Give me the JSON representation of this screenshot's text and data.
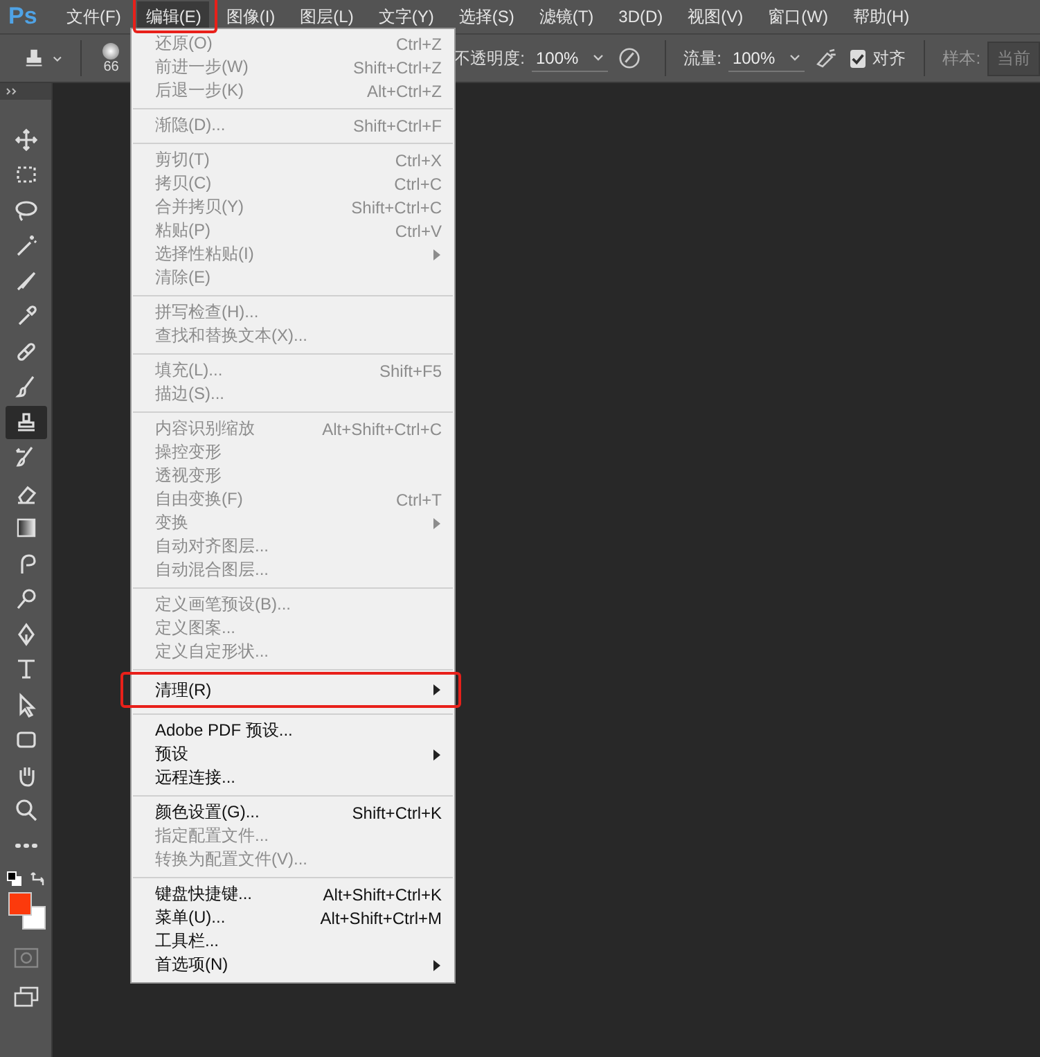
{
  "menubar": {
    "logo": "Ps",
    "items": [
      {
        "label": "文件(F)",
        "selected": false,
        "annotated": false
      },
      {
        "label": "编辑(E)",
        "selected": true,
        "annotated": true
      },
      {
        "label": "图像(I)",
        "selected": false,
        "annotated": false
      },
      {
        "label": "图层(L)",
        "selected": false,
        "annotated": false
      },
      {
        "label": "文字(Y)",
        "selected": false,
        "annotated": false
      },
      {
        "label": "选择(S)",
        "selected": false,
        "annotated": false
      },
      {
        "label": "滤镜(T)",
        "selected": false,
        "annotated": false
      },
      {
        "label": "3D(D)",
        "selected": false,
        "annotated": false
      },
      {
        "label": "视图(V)",
        "selected": false,
        "annotated": false
      },
      {
        "label": "窗口(W)",
        "selected": false,
        "annotated": false
      },
      {
        "label": "帮助(H)",
        "selected": false,
        "annotated": false
      }
    ]
  },
  "options_bar": {
    "brush_size": "66",
    "opacity_label": "不透明度:",
    "opacity_value": "100%",
    "flow_label": "流量:",
    "flow_value": "100%",
    "aligned": {
      "label": "对齐",
      "checked": true
    },
    "sample_label": "样本:",
    "sample_value": "当前"
  },
  "toolbar": {
    "tools": [
      {
        "selected": false
      },
      {
        "selected": false
      },
      {
        "selected": false
      },
      {
        "selected": false
      },
      {
        "selected": false
      },
      {
        "selected": false
      },
      {
        "selected": false
      },
      {
        "selected": false
      },
      {
        "selected": true
      },
      {
        "selected": false
      },
      {
        "selected": false
      },
      {
        "selected": false
      },
      {
        "selected": false
      },
      {
        "selected": false
      },
      {
        "selected": false
      },
      {
        "selected": false
      },
      {
        "selected": false
      },
      {
        "selected": false
      },
      {
        "selected": false
      },
      {
        "selected": false
      },
      {
        "selected": false
      }
    ]
  },
  "edit_menu": {
    "groups": [
      {
        "items": [
          {
            "label": "还原(O)",
            "shortcut": "Ctrl+Z",
            "disabled": true,
            "submenu": false,
            "annotated": false
          },
          {
            "label": "前进一步(W)",
            "shortcut": "Shift+Ctrl+Z",
            "disabled": true,
            "submenu": false,
            "annotated": false
          },
          {
            "label": "后退一步(K)",
            "shortcut": "Alt+Ctrl+Z",
            "disabled": true,
            "submenu": false,
            "annotated": false
          }
        ]
      },
      {
        "items": [
          {
            "label": "渐隐(D)...",
            "shortcut": "Shift+Ctrl+F",
            "disabled": true,
            "submenu": false,
            "annotated": false
          }
        ]
      },
      {
        "items": [
          {
            "label": "剪切(T)",
            "shortcut": "Ctrl+X",
            "disabled": true,
            "submenu": false,
            "annotated": false
          },
          {
            "label": "拷贝(C)",
            "shortcut": "Ctrl+C",
            "disabled": true,
            "submenu": false,
            "annotated": false
          },
          {
            "label": "合并拷贝(Y)",
            "shortcut": "Shift+Ctrl+C",
            "disabled": true,
            "submenu": false,
            "annotated": false
          },
          {
            "label": "粘贴(P)",
            "shortcut": "Ctrl+V",
            "disabled": true,
            "submenu": false,
            "annotated": false
          },
          {
            "label": "选择性粘贴(I)",
            "disabled": true,
            "submenu": true,
            "annotated": false
          },
          {
            "label": "清除(E)",
            "disabled": true,
            "submenu": false,
            "annotated": false
          }
        ]
      },
      {
        "items": [
          {
            "label": "拼写检查(H)...",
            "disabled": true,
            "submenu": false,
            "annotated": false
          },
          {
            "label": "查找和替换文本(X)...",
            "disabled": true,
            "submenu": false,
            "annotated": false
          }
        ]
      },
      {
        "items": [
          {
            "label": "填充(L)...",
            "shortcut": "Shift+F5",
            "disabled": true,
            "submenu": false,
            "annotated": false
          },
          {
            "label": "描边(S)...",
            "disabled": true,
            "submenu": false,
            "annotated": false
          }
        ]
      },
      {
        "items": [
          {
            "label": "内容识别缩放",
            "shortcut": "Alt+Shift+Ctrl+C",
            "disabled": true,
            "submenu": false,
            "annotated": false
          },
          {
            "label": "操控变形",
            "disabled": true,
            "submenu": false,
            "annotated": false
          },
          {
            "label": "透视变形",
            "disabled": true,
            "submenu": false,
            "annotated": false
          },
          {
            "label": "自由变换(F)",
            "shortcut": "Ctrl+T",
            "disabled": true,
            "submenu": false,
            "annotated": false
          },
          {
            "label": "变换",
            "disabled": true,
            "submenu": true,
            "annotated": false
          },
          {
            "label": "自动对齐图层...",
            "disabled": true,
            "submenu": false,
            "annotated": false
          },
          {
            "label": "自动混合图层...",
            "disabled": true,
            "submenu": false,
            "annotated": false
          }
        ]
      },
      {
        "items": [
          {
            "label": "定义画笔预设(B)...",
            "disabled": true,
            "submenu": false,
            "annotated": false
          },
          {
            "label": "定义图案...",
            "disabled": true,
            "submenu": false,
            "annotated": false
          },
          {
            "label": "定义自定形状...",
            "disabled": true,
            "submenu": false,
            "annotated": false
          }
        ]
      },
      {
        "items": [
          {
            "label": "清理(R)",
            "disabled": false,
            "submenu": true,
            "annotated": true
          }
        ]
      },
      {
        "items": [
          {
            "label": "Adobe PDF 预设...",
            "disabled": false,
            "submenu": false,
            "annotated": false
          },
          {
            "label": "预设",
            "disabled": false,
            "submenu": true,
            "annotated": false
          },
          {
            "label": "远程连接...",
            "disabled": false,
            "submenu": false,
            "annotated": false
          }
        ]
      },
      {
        "items": [
          {
            "label": "颜色设置(G)...",
            "shortcut": "Shift+Ctrl+K",
            "disabled": false,
            "submenu": false,
            "annotated": false
          },
          {
            "label": "指定配置文件...",
            "disabled": true,
            "submenu": false,
            "annotated": false
          },
          {
            "label": "转换为配置文件(V)...",
            "disabled": true,
            "submenu": false,
            "annotated": false
          }
        ]
      },
      {
        "items": [
          {
            "label": "键盘快捷键...",
            "shortcut": "Alt+Shift+Ctrl+K",
            "disabled": false,
            "submenu": false,
            "annotated": false
          },
          {
            "label": "菜单(U)...",
            "shortcut": "Alt+Shift+Ctrl+M",
            "disabled": false,
            "submenu": false,
            "annotated": false
          },
          {
            "label": "工具栏...",
            "disabled": false,
            "submenu": false,
            "annotated": false
          },
          {
            "label": "首选项(N)",
            "disabled": false,
            "submenu": true,
            "annotated": false
          }
        ]
      }
    ]
  }
}
